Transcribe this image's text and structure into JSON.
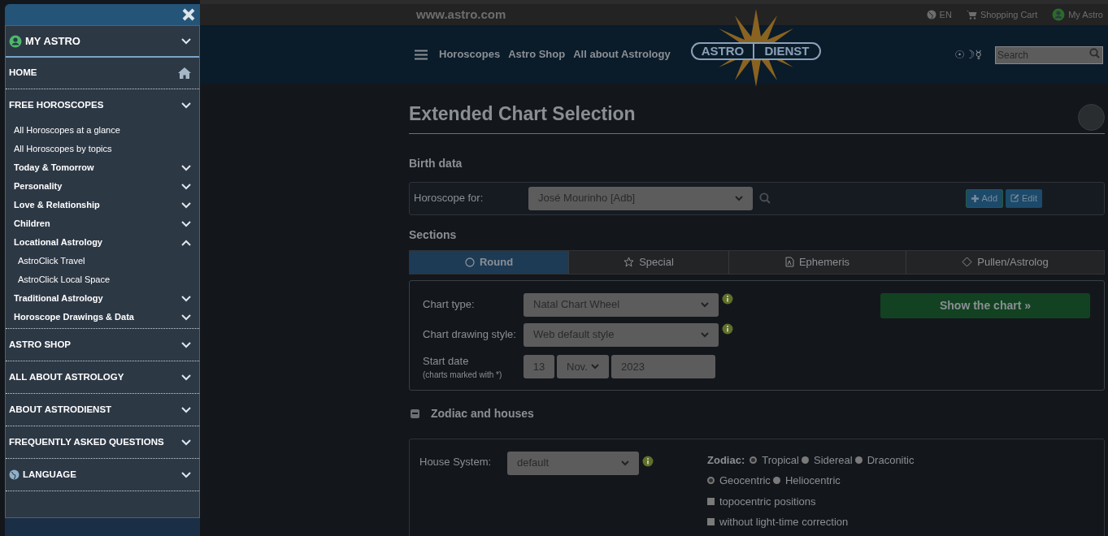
{
  "topbar": {
    "site": "www.astro.com",
    "language": "EN",
    "cart": "Shopping Cart",
    "account": "My Astro"
  },
  "nav": {
    "links": [
      "Horoscopes",
      "Astro Shop",
      "All about Astrology"
    ],
    "logo": [
      "ASTRO",
      "DIENST"
    ],
    "symbols": "☉☽☿",
    "search": {
      "placeholder": "Search"
    }
  },
  "sidebar": {
    "sections": [
      {
        "kind": "account",
        "label": "MY ASTRO"
      },
      {
        "kind": "home",
        "label": "HOME"
      },
      {
        "kind": "section",
        "label": "FREE HOROSCOPES",
        "children": [
          {
            "kind": "link",
            "label": "All Horoscopes at a glance"
          },
          {
            "kind": "link",
            "label": "All Horoscopes by topics"
          },
          {
            "kind": "group",
            "label": "Today & Tomorrow",
            "expanded": false
          },
          {
            "kind": "group",
            "label": "Personality",
            "expanded": false
          },
          {
            "kind": "group",
            "label": "Love & Relationship",
            "expanded": false
          },
          {
            "kind": "group",
            "label": "Children",
            "expanded": false
          },
          {
            "kind": "group",
            "label": "Locational Astrology",
            "expanded": true,
            "children": [
              {
                "label": "AstroClick Travel"
              },
              {
                "label": "AstroClick Local Space"
              }
            ]
          },
          {
            "kind": "group",
            "label": "Traditional Astrology",
            "expanded": false
          },
          {
            "kind": "group",
            "label": "Horoscope Drawings & Data",
            "expanded": false
          }
        ]
      },
      {
        "kind": "section",
        "label": "ASTRO SHOP"
      },
      {
        "kind": "section",
        "label": "ALL ABOUT ASTROLOGY"
      },
      {
        "kind": "section",
        "label": "ABOUT ASTRODIENST"
      },
      {
        "kind": "section",
        "label": "FREQUENTLY ASKED QUESTIONS"
      },
      {
        "kind": "language",
        "label": "LANGUAGE"
      }
    ]
  },
  "page": {
    "title": "Extended Chart Selection",
    "birth_data": {
      "heading": "Birth data",
      "label": "Horoscope for:",
      "value": "José Mourinho [Adb]",
      "add": "Add",
      "edit": "Edit"
    },
    "sections": {
      "heading": "Sections",
      "tabs": [
        {
          "label": "Round",
          "selected": true
        },
        {
          "label": "Special",
          "selected": false
        },
        {
          "label": "Ephemeris",
          "selected": false
        },
        {
          "label": "Pullen/Astrolog",
          "selected": false
        }
      ]
    },
    "chart_form": {
      "chart_type": {
        "label": "Chart type:",
        "value": "Natal Chart Wheel"
      },
      "style": {
        "label": "Chart drawing style:",
        "value": "Web default style"
      },
      "start_date": {
        "label": "Start date",
        "note": "(charts marked with *)",
        "day": "13",
        "month": "Nov.",
        "year": "2023"
      },
      "submit": "Show the chart »"
    },
    "zodiac_houses": {
      "heading": "Zodiac and houses",
      "expanded": true,
      "house_system": {
        "label": "House System:",
        "value": "default"
      },
      "zodiac_label": "Zodiac:",
      "zodiac": [
        {
          "label": "Tropical",
          "selected": true
        },
        {
          "label": "Sidereal",
          "selected": false
        },
        {
          "label": "Draconitic",
          "selected": false
        }
      ],
      "center": [
        {
          "label": "Geocentric",
          "selected": true
        },
        {
          "label": "Heliocentric",
          "selected": false
        }
      ],
      "options": [
        {
          "label": "topocentric positions",
          "checked": false
        },
        {
          "label": "without light-time correction",
          "checked": false
        }
      ]
    }
  }
}
